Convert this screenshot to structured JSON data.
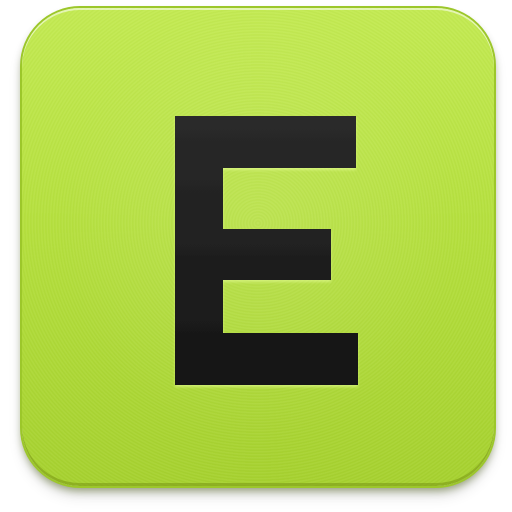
{
  "icon": {
    "letter": "E",
    "background_color": "#b5e03e",
    "glyph_color": "#1d1d1d"
  }
}
